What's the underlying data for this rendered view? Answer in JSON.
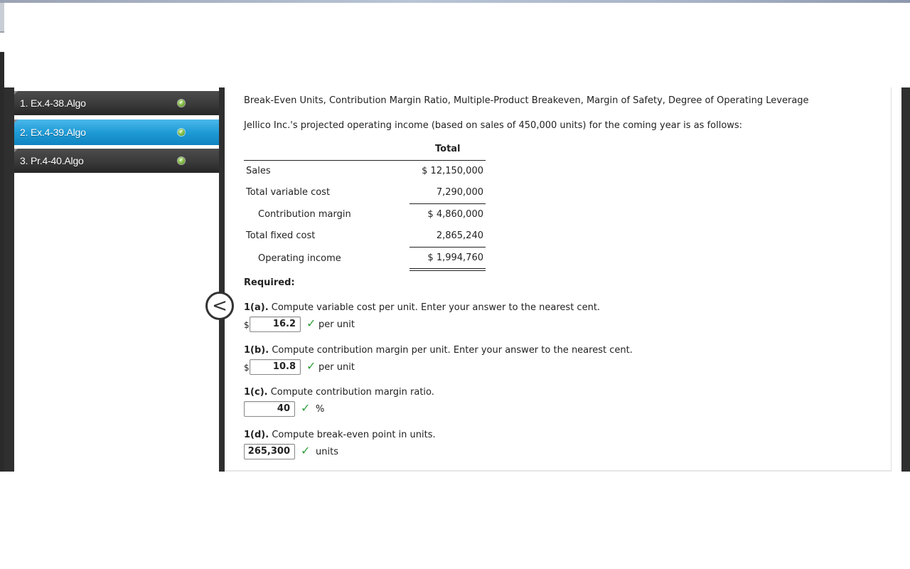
{
  "sidebar": {
    "items": [
      {
        "label": "1. Ex.4-38.Algo",
        "status": "completed",
        "active": false
      },
      {
        "label": "2. Ex.4-39.Algo",
        "status": "completed",
        "active": true
      },
      {
        "label": "3. Pr.4-40.Algo",
        "status": "completed",
        "active": false
      }
    ]
  },
  "collapse_icon": "chevron-left-icon",
  "main": {
    "title": "Break-Even Units, Contribution Margin Ratio, Multiple-Product Breakeven, Margin of Safety, Degree of Operating Leverage",
    "intro": "Jellico Inc.'s projected operating income (based on sales of 450,000 units) for the coming year is as follows:",
    "table": {
      "header": "Total",
      "rows": [
        {
          "label": "Sales",
          "value": "$ 12,150,000"
        },
        {
          "label": "Total variable cost",
          "value": "7,290,000"
        },
        {
          "label": "Contribution margin",
          "value": "$ 4,860,000"
        },
        {
          "label": "Total fixed cost",
          "value": "2,865,240"
        },
        {
          "label": "Operating income",
          "value": "$ 1,994,760"
        }
      ]
    },
    "required_label": "Required:",
    "questions": [
      {
        "id": "1(a).",
        "text": " Compute variable cost per unit. Enter your answer to the nearest cent.",
        "prefix": "$",
        "answer": "16.2",
        "suffix": "per unit",
        "correct": true
      },
      {
        "id": "1(b).",
        "text": " Compute contribution margin per unit. Enter your answer to the nearest cent.",
        "prefix": "$",
        "answer": "10.8",
        "suffix": "per unit",
        "correct": true
      },
      {
        "id": "1(c).",
        "text": " Compute contribution margin ratio.",
        "prefix": "",
        "answer": "40",
        "suffix": "%",
        "correct": true
      },
      {
        "id": "1(d).",
        "text": " Compute break-even point in units.",
        "prefix": "",
        "answer": "265,300",
        "suffix": "units",
        "correct": true
      }
    ],
    "check_glyph": "✓"
  },
  "colors": {
    "active_item": "#1f9bd6",
    "dark_item": "#3a3a3a",
    "check_green": "#2e9e3a"
  }
}
